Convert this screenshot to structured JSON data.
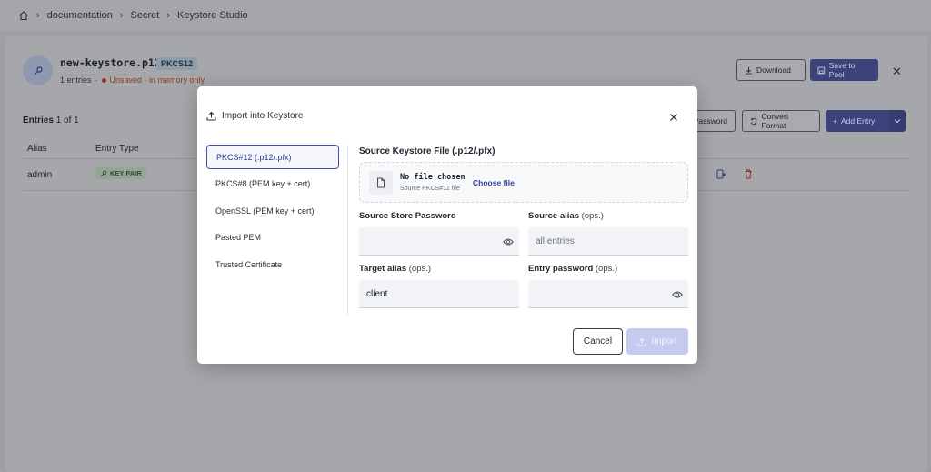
{
  "breadcrumb": [
    "documentation",
    "Secret",
    "Keystore Studio"
  ],
  "keystore": {
    "name": "new-keystore.p12",
    "type": "PKCS12",
    "entries_count": "1 entries",
    "unsaved": "Unsaved · in memory only"
  },
  "toolbar": {
    "download": "Download",
    "save_to_pool": "Save to Pool",
    "password": "Password",
    "convert_format": "Convert Format",
    "add_entry": "Add Entry"
  },
  "entries": {
    "title": "Entries",
    "count": "1 of 1",
    "columns": [
      "Alias",
      "Entry Type"
    ],
    "rows": [
      {
        "alias": "admin",
        "type": "KEY PAIR"
      }
    ]
  },
  "modal": {
    "title": "Import into Keystore",
    "nav": [
      "PKCS#12 (.p12/.pfx)",
      "PKCS#8 (PEM key + cert)",
      "OpenSSL (PEM key + cert)",
      "Pasted PEM",
      "Trusted Certificate"
    ],
    "source_file_label": "Source Keystore File (.p12/.pfx)",
    "no_file": "No file chosen",
    "no_file_sub": "Source PKCS#12 file",
    "choose_file": "Choose file",
    "source_password_label": "Source Store Password",
    "source_alias_label": "Source alias",
    "target_alias_label": "Target alias",
    "entry_password_label": "Entry password",
    "optional": "(ops.)",
    "source_alias_placeholder": "all entries",
    "target_alias_value": "client",
    "cancel": "Cancel",
    "import": "Import"
  },
  "colors": {
    "accent": "#3f4fb5",
    "link": "#2e3fa8",
    "import_disabled": "#c5caef",
    "unsaved": "#c0502a"
  }
}
